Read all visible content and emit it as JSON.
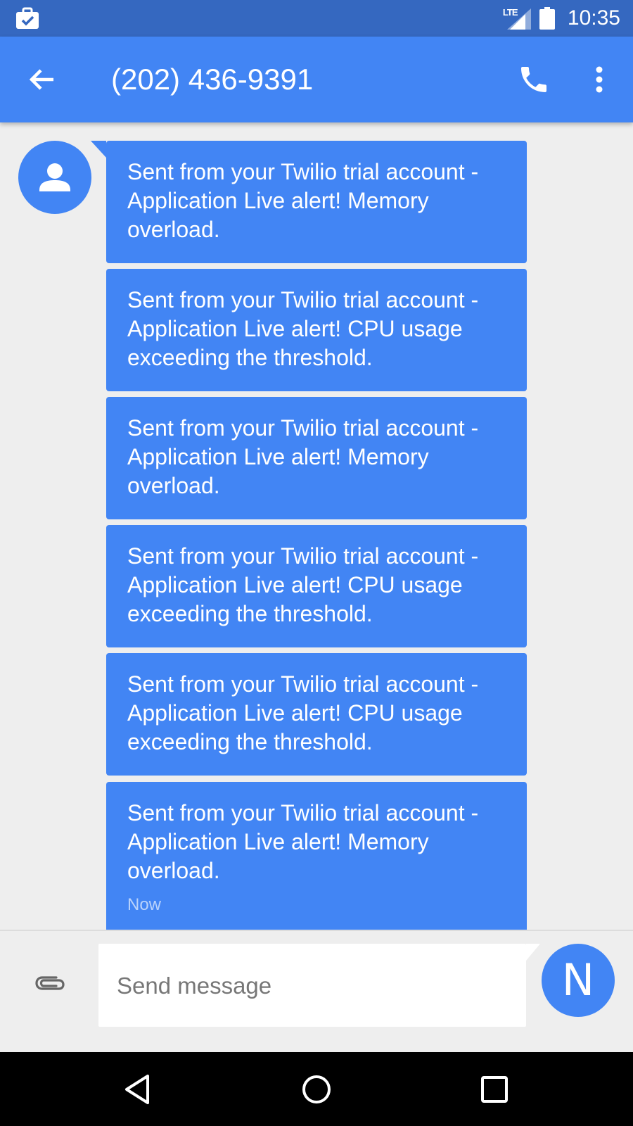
{
  "status_bar": {
    "network_label": "LTE",
    "time": "10:35"
  },
  "app_bar": {
    "title": "(202) 436-9391",
    "icons": [
      "back-arrow-icon",
      "phone-icon",
      "more-vert-icon"
    ]
  },
  "conversation": {
    "contact_icon": "person-icon",
    "messages": [
      {
        "text": "Sent from your Twilio trial account - Application Live alert! Memory overload."
      },
      {
        "text": "Sent from your Twilio trial account - Application Live alert! CPU usage exceeding the threshold."
      },
      {
        "text": "Sent from your Twilio trial account - Application Live alert! Memory overload."
      },
      {
        "text": "Sent from your Twilio trial account - Application Live alert! CPU usage exceeding the threshold."
      },
      {
        "text": "Sent from your Twilio trial account - Application Live alert! CPU usage exceeding the threshold."
      },
      {
        "text": "Sent from your Twilio trial account - Application Live alert! Memory overload.",
        "timestamp": "Now"
      }
    ]
  },
  "compose": {
    "placeholder": "Send message",
    "value": "",
    "send_avatar_letter": "N",
    "attach_icon": "paperclip-icon"
  },
  "nav_bar": {
    "icons": [
      "back-triangle-icon",
      "home-circle-icon",
      "recents-square-icon"
    ]
  },
  "colors": {
    "status_bar": "#3568c0",
    "app_bar": "#4285f4",
    "bubble": "#4285f4",
    "background": "#eeeeee"
  }
}
